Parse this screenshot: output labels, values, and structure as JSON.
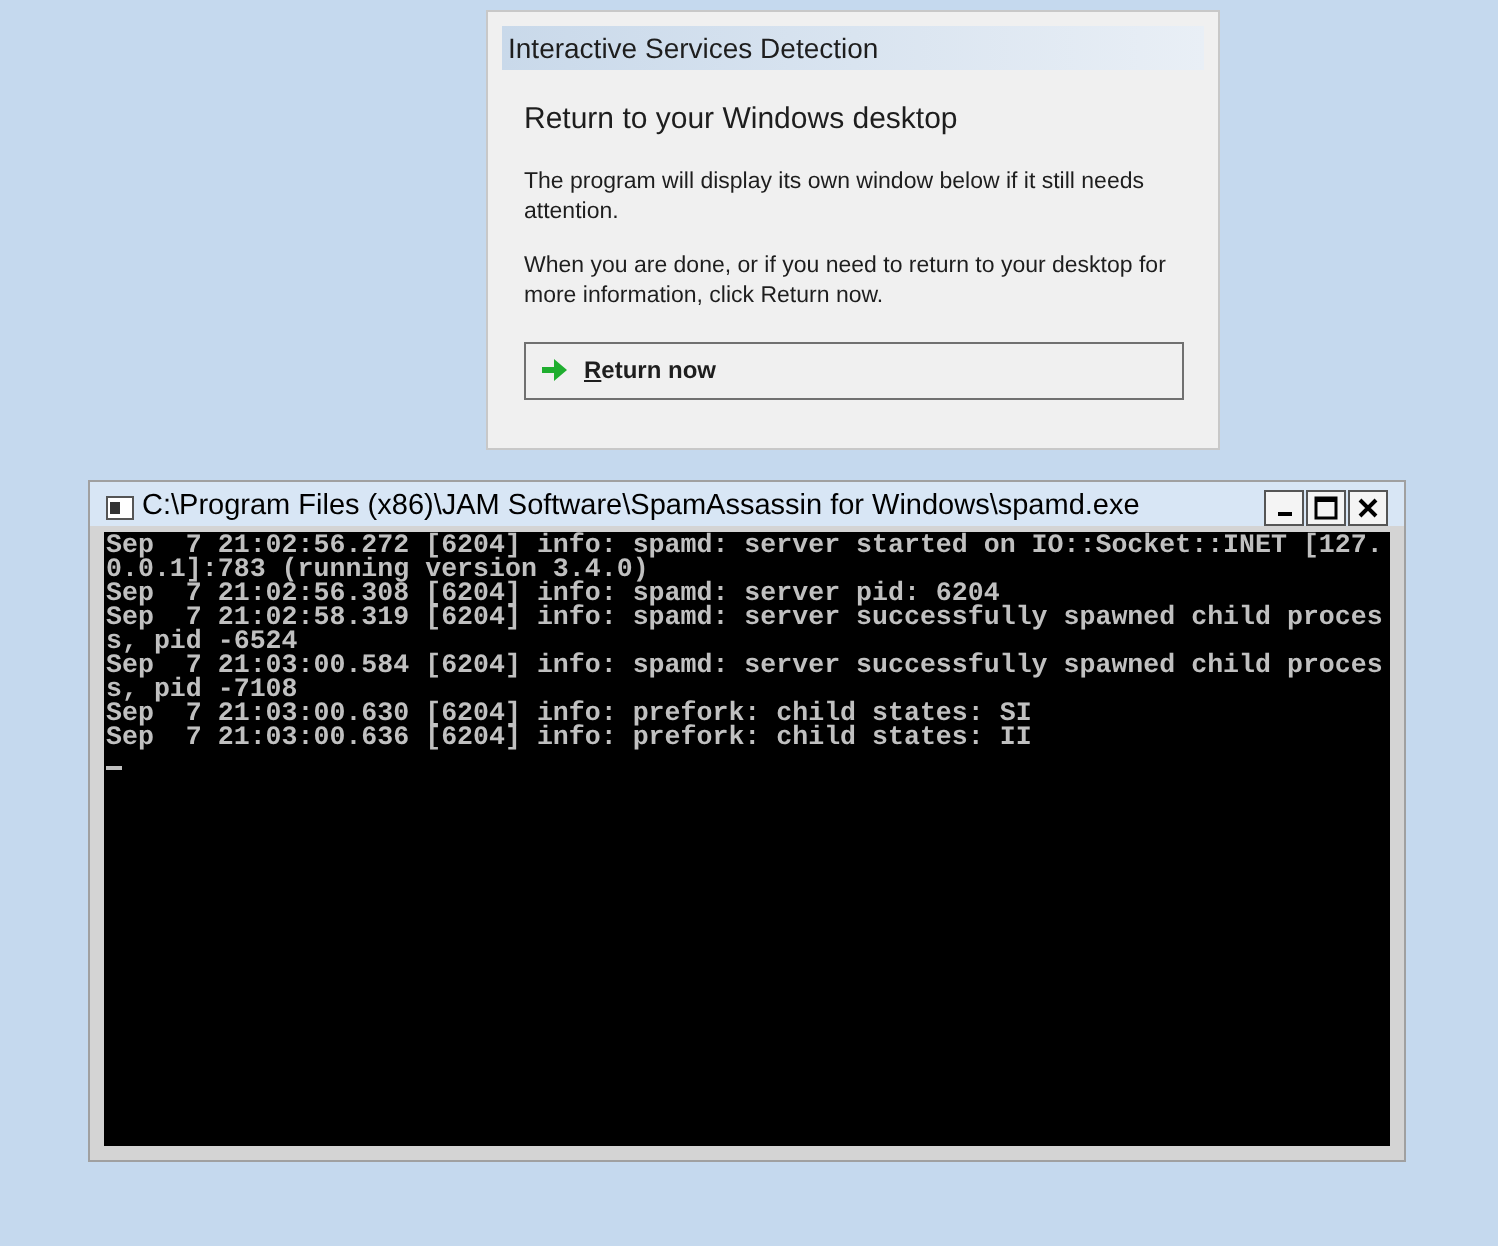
{
  "dialog": {
    "title": "Interactive Services Detection",
    "heading": "Return to your Windows desktop",
    "paragraphs": [
      "The program will display its own window below if it still needs attention.",
      "When you are done, or if you need to return to your desktop for more information, click Return now."
    ],
    "button": "Return now"
  },
  "console": {
    "title": "C:\\Program Files (x86)\\JAM Software\\SpamAssassin for Windows\\spamd.exe",
    "buttons": [
      {
        "kind": "minimize"
      },
      {
        "kind": "maximize"
      },
      {
        "kind": "close"
      }
    ],
    "lines": [
      "Sep  7 21:02:56.272 [6204] info: spamd: server started on IO::Socket::INET [127.",
      "0.0.1]:783 (running version 3.4.0)",
      "Sep  7 21:02:56.308 [6204] info: spamd: server pid: 6204",
      "Sep  7 21:02:58.319 [6204] info: spamd: server successfully spawned child proces",
      "s, pid -6524",
      "Sep  7 21:03:00.584 [6204] info: spamd: server successfully spawned child proces",
      "s, pid -7108",
      "Sep  7 21:03:00.630 [6204] info: prefork: child states: SI",
      "Sep  7 21:03:00.636 [6204] info: prefork: child states: II"
    ]
  }
}
